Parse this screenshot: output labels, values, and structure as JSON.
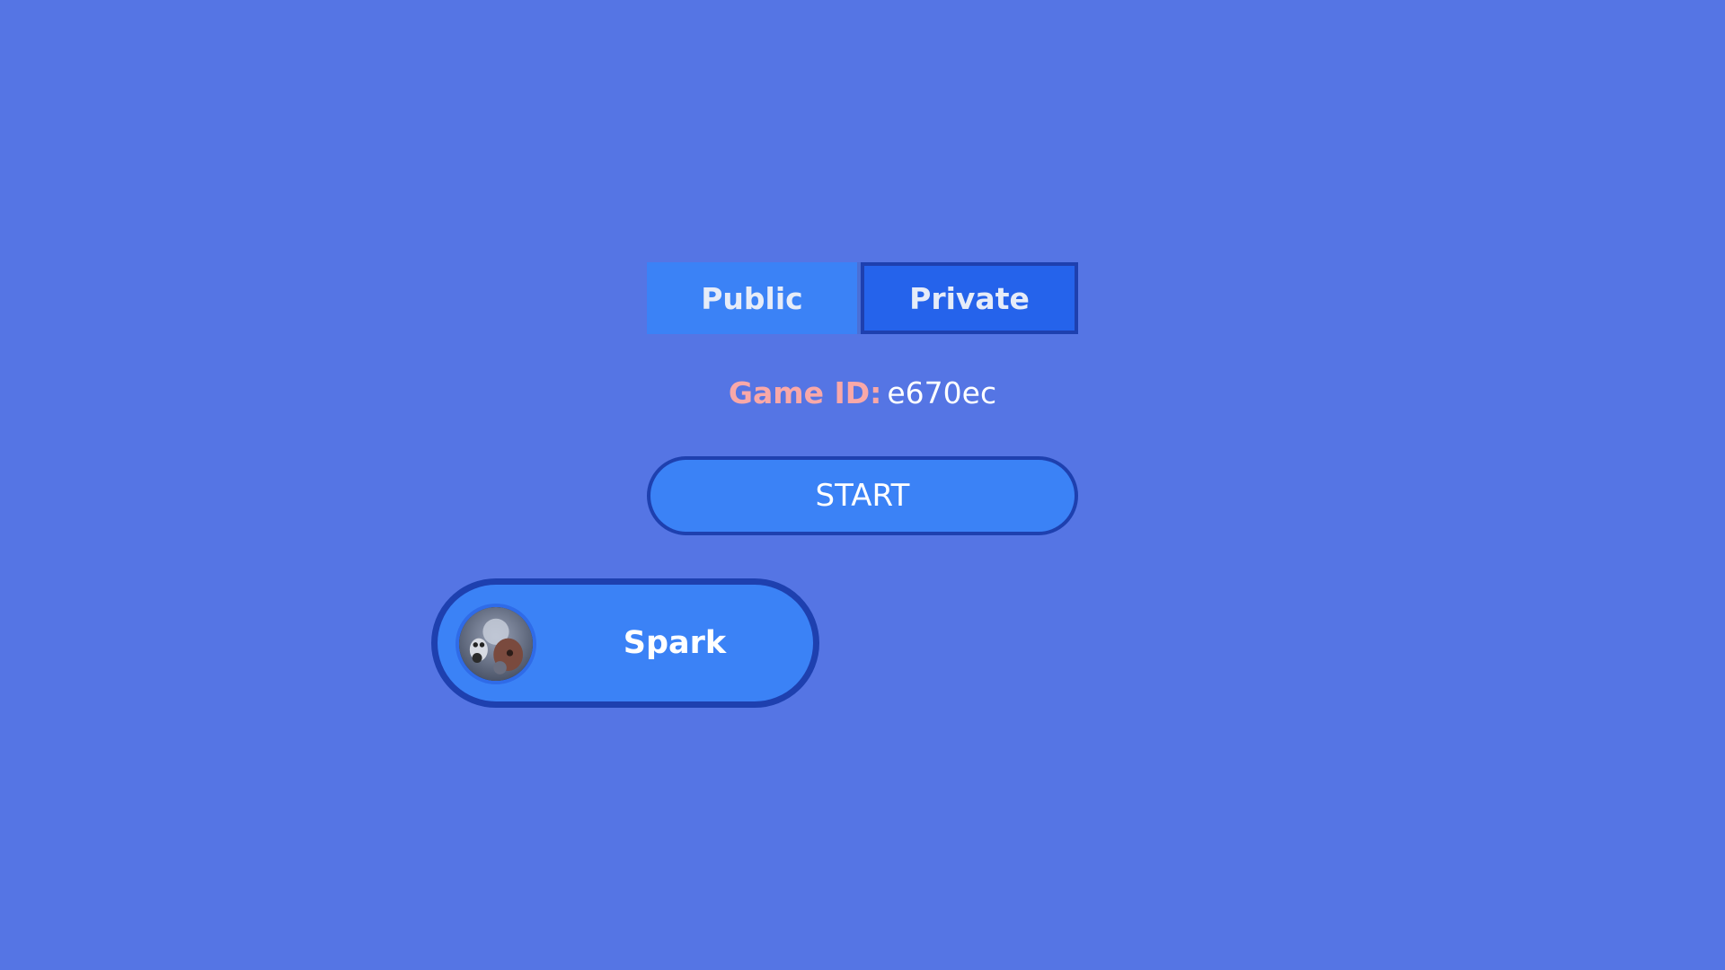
{
  "lobby": {
    "mode_toggle": {
      "public_label": "Public",
      "private_label": "Private",
      "selected": "Private"
    },
    "game_id": {
      "label": "Game ID:",
      "value": "e670ec"
    },
    "start_label": "START",
    "players": [
      {
        "name": "Spark",
        "avatar_icon": "player-avatar-image"
      }
    ]
  },
  "colors": {
    "background": "#5575e4",
    "button": "#3b82f6",
    "button_selected": "#2563eb",
    "border": "#1e40af",
    "game_id_label": "#f9a8a8",
    "text": "#ffffff"
  }
}
